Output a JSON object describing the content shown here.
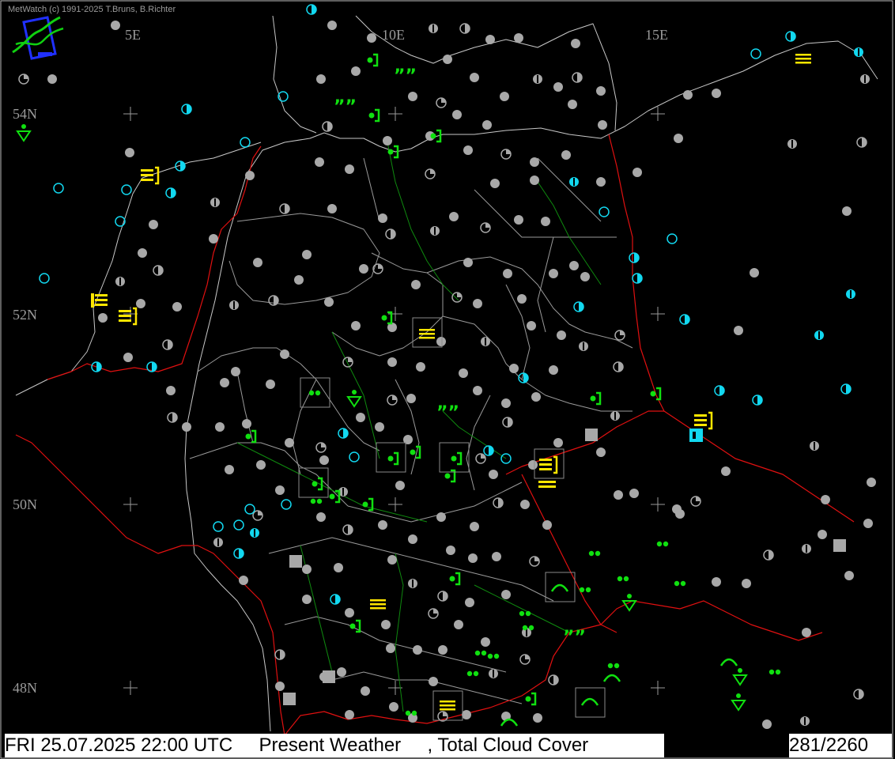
{
  "copyright": "MetWatch  (c) 1991-2025 T.Bruns, B.Richter",
  "grid_labels": {
    "lon_5e": "5E",
    "lon_10e": "10E",
    "lon_15e": "15E",
    "lat_54n": "54N",
    "lat_52n": "52N",
    "lat_50n": "50N",
    "lat_48n": "48N"
  },
  "status": {
    "datetime_product": "FRI 25.07.2025 22:00 UTC     Present Weather     , Total Cloud Cover",
    "counter": "281/2260"
  },
  "colors": {
    "background": "#000000",
    "coastline": "#c8c8c8",
    "border": "#e01010",
    "river": "#0f8a0f",
    "station_gray": "#a8a8a8",
    "station_cyan": "#12d8f0",
    "rain": "#10e010",
    "fog": "#ffe600",
    "status_bg": "#ffffff"
  },
  "legend_icon": "metwatch-logo-icon"
}
